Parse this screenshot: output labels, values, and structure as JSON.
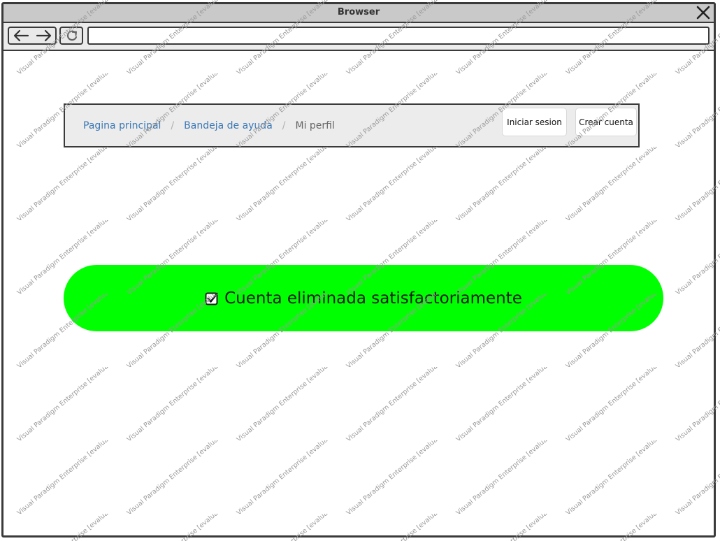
{
  "window": {
    "title": "Browser"
  },
  "toolbar": {
    "address_value": "",
    "address_placeholder": ""
  },
  "navbar": {
    "breadcrumbs": [
      {
        "label": "Pagina principal"
      },
      {
        "label": "Bandeja de ayuda"
      },
      {
        "label": "Mi perfil"
      }
    ],
    "separator": "/",
    "login_label": "Iniciar sesion",
    "signup_label": "Crear cuenta"
  },
  "alert": {
    "message": "Cuenta eliminada satisfactoriamente",
    "icon": "checkbox-checked-icon",
    "background_color": "#00ff00"
  },
  "watermark": {
    "text": "Visual Paradigm Enterprise [evaluation copy]"
  },
  "icons": {
    "close": "close-icon",
    "back": "arrow-left-icon",
    "forward": "arrow-right-icon",
    "reload": "reload-icon"
  }
}
